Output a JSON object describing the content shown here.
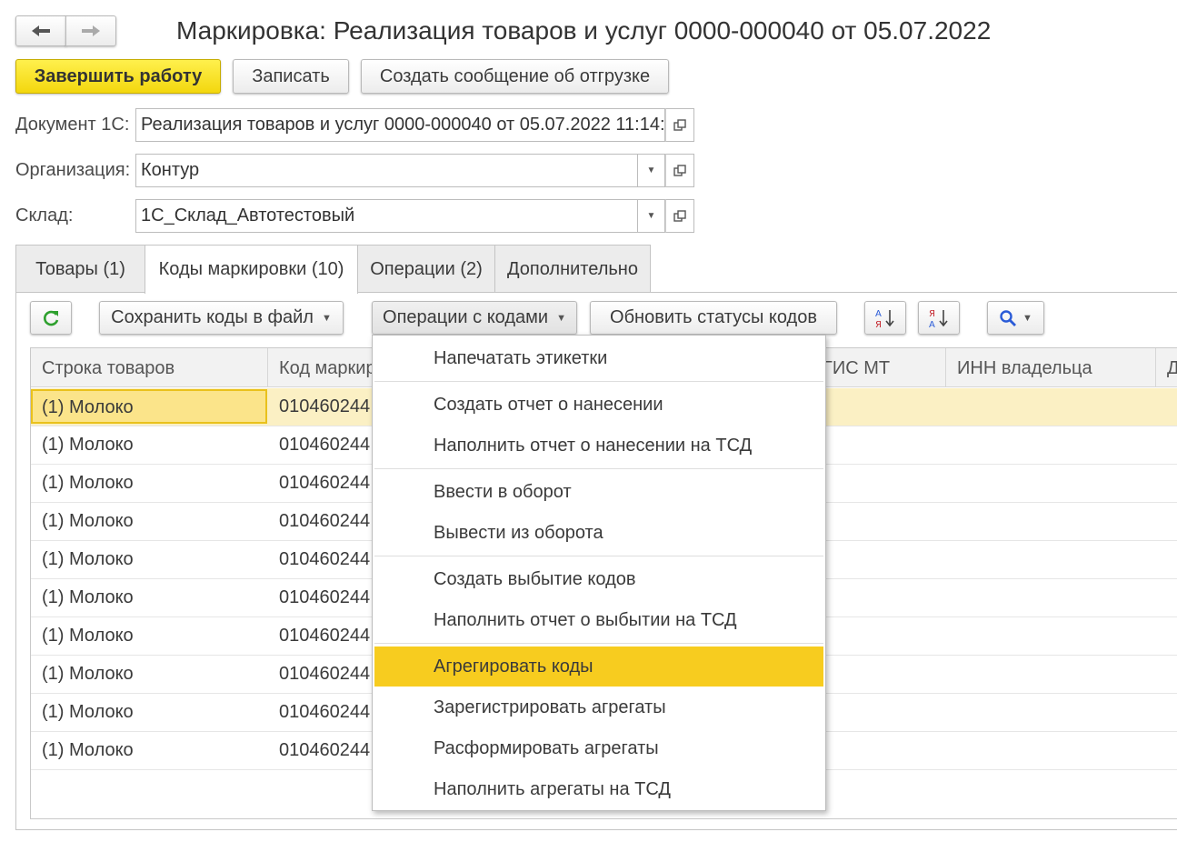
{
  "window": {
    "title": "Маркировка: Реализация товаров и услуг 0000-000040 от 05.07.2022"
  },
  "nav": {
    "back_icon": "arrow-left-icon",
    "forward_icon": "arrow-right-icon"
  },
  "actions": {
    "finish": "Завершить работу",
    "save": "Записать",
    "create_shipment_message": "Создать сообщение об отгрузке"
  },
  "form": {
    "document_label": "Документ 1С:",
    "document_value": "Реализация товаров и услуг 0000-000040 от 05.07.2022 11:14:",
    "organization_label": "Организация:",
    "organization_value": "Контур",
    "warehouse_label": "Склад:",
    "warehouse_value": "1С_Склад_Автотестовый"
  },
  "tabs": [
    {
      "label": "Товары (1)"
    },
    {
      "label": "Коды маркировки (10)",
      "active": true
    },
    {
      "label": "Операции (2)"
    },
    {
      "label": "Дополнительно"
    }
  ],
  "toolbar": {
    "refresh_icon": "refresh-icon",
    "save_codes_to_file": "Сохранить коды в файл",
    "code_operations": "Операции с кодами",
    "update_code_statuses": "Обновить статусы кодов",
    "sort_asc_icon": "sort-ascending-icon",
    "sort_desc_icon": "sort-descending-icon",
    "search_icon": "search-icon"
  },
  "table": {
    "columns": [
      "Строка товаров",
      "Код маркир",
      "ГИС МТ",
      "ИНН владельца",
      "Д"
    ],
    "rows": [
      {
        "line": "(1) Молоко",
        "code": "010460244"
      },
      {
        "line": "(1) Молоко",
        "code": "010460244"
      },
      {
        "line": "(1) Молоко",
        "code": "010460244"
      },
      {
        "line": "(1) Молоко",
        "code": "010460244"
      },
      {
        "line": "(1) Молоко",
        "code": "010460244"
      },
      {
        "line": "(1) Молоко",
        "code": "010460244"
      },
      {
        "line": "(1) Молоко",
        "code": "010460244"
      },
      {
        "line": "(1) Молоко",
        "code": "010460244"
      },
      {
        "line": "(1) Молоко",
        "code": "010460244"
      },
      {
        "line": "(1) Молоко",
        "code": "010460244"
      }
    ]
  },
  "dropdown_menu": {
    "items": [
      "Напечатать этикетки",
      "Создать отчет о нанесении",
      "Наполнить отчет о нанесении на ТСД",
      "Ввести в оборот",
      "Вывести из оборота",
      "Создать выбытие кодов",
      "Наполнить отчет о выбытии на ТСД",
      "Агрегировать коды",
      "Зарегистрировать агрегаты",
      "Расформировать агрегаты",
      "Наполнить агрегаты на ТСД"
    ],
    "highlighted": "Агрегировать коды"
  },
  "colors": {
    "accent_yellow": "#f7cc1f",
    "selected_row": "#fbf0c4"
  }
}
